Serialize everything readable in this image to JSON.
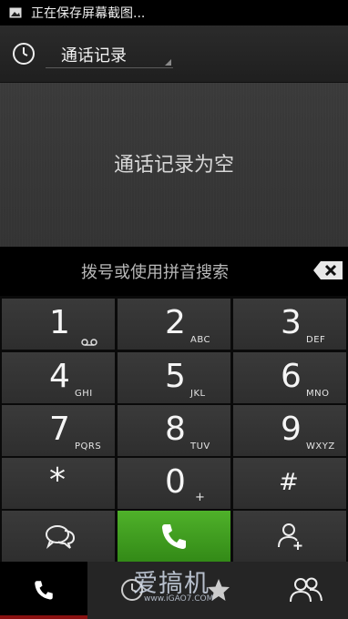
{
  "status": {
    "text": "正在保存屏幕截图..."
  },
  "header": {
    "title": "通话记录"
  },
  "calllog": {
    "empty_text": "通话记录为空"
  },
  "search": {
    "hint": "拨号或使用拼音搜索"
  },
  "keys": [
    {
      "digit": "1",
      "letters": ""
    },
    {
      "digit": "2",
      "letters": "ABC"
    },
    {
      "digit": "3",
      "letters": "DEF"
    },
    {
      "digit": "4",
      "letters": "GHI"
    },
    {
      "digit": "5",
      "letters": "JKL"
    },
    {
      "digit": "6",
      "letters": "MNO"
    },
    {
      "digit": "7",
      "letters": "PQRS"
    },
    {
      "digit": "8",
      "letters": "TUV"
    },
    {
      "digit": "9",
      "letters": "WXYZ"
    },
    {
      "digit": "*",
      "letters": ""
    },
    {
      "digit": "0",
      "letters": "+"
    },
    {
      "digit": "#",
      "letters": ""
    }
  ],
  "watermark": {
    "brand": "爱搞机",
    "url": "www.iGAO7.COM"
  },
  "colors": {
    "call_green": "#3f9a1f",
    "active_tab_indicator": "#8a1010"
  }
}
